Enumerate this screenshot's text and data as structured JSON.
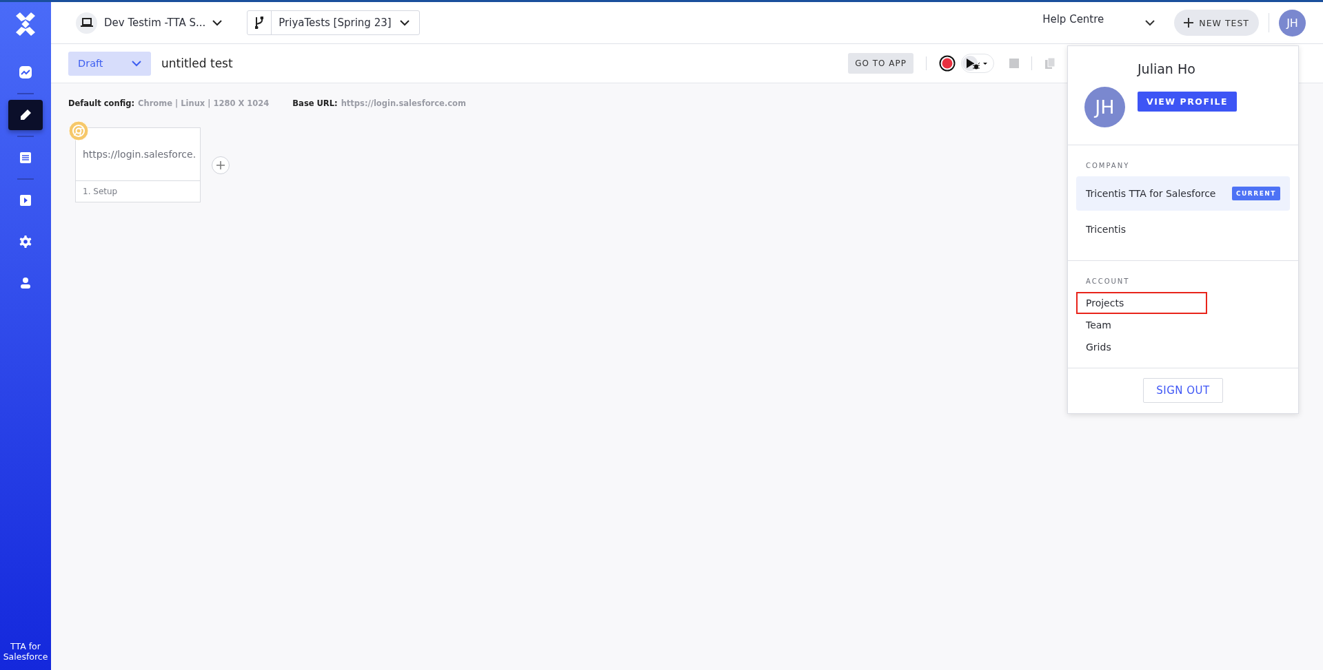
{
  "sidebar": {
    "items": [
      {
        "kind": "chart",
        "selected": false
      },
      {
        "kind": "edit",
        "selected": true
      },
      {
        "kind": "list",
        "selected": false
      },
      {
        "kind": "play",
        "selected": false
      },
      {
        "kind": "settings",
        "selected": false
      },
      {
        "kind": "user",
        "selected": false
      }
    ],
    "footer": "TTA for Salesforce"
  },
  "header": {
    "project": "Dev Testim -TTA S...",
    "branch": "PriyaTests [Spring 23]",
    "help": "Help Centre",
    "new_test": "NEW TEST",
    "avatar": "JH"
  },
  "toolbar": {
    "status": "Draft",
    "test_name": "untitled test",
    "go_to_app": "GO TO APP"
  },
  "config": {
    "default_label": "Default config:",
    "default_value": "Chrome | Linux | 1280 X 1024",
    "base_label": "Base URL:",
    "base_value": "https://login.salesforce.com"
  },
  "steps": [
    {
      "url": "https://login.salesforce.",
      "label": "1. Setup"
    }
  ],
  "profile_menu": {
    "avatar": "JH",
    "name": "Julian Ho",
    "view_profile": "VIEW PROFILE",
    "company_heading": "COMPANY",
    "companies": [
      {
        "name": "Tricentis TTA for Salesforce",
        "selected": true,
        "badge": "CURRENT"
      },
      {
        "name": "Tricentis",
        "selected": false
      }
    ],
    "account_heading": "ACCOUNT",
    "account_items": [
      {
        "label": "Projects",
        "outlined": true
      },
      {
        "label": "Team",
        "outlined": false
      },
      {
        "label": "Grids",
        "outlined": false
      }
    ],
    "sign_out": "SIGN OUT"
  }
}
